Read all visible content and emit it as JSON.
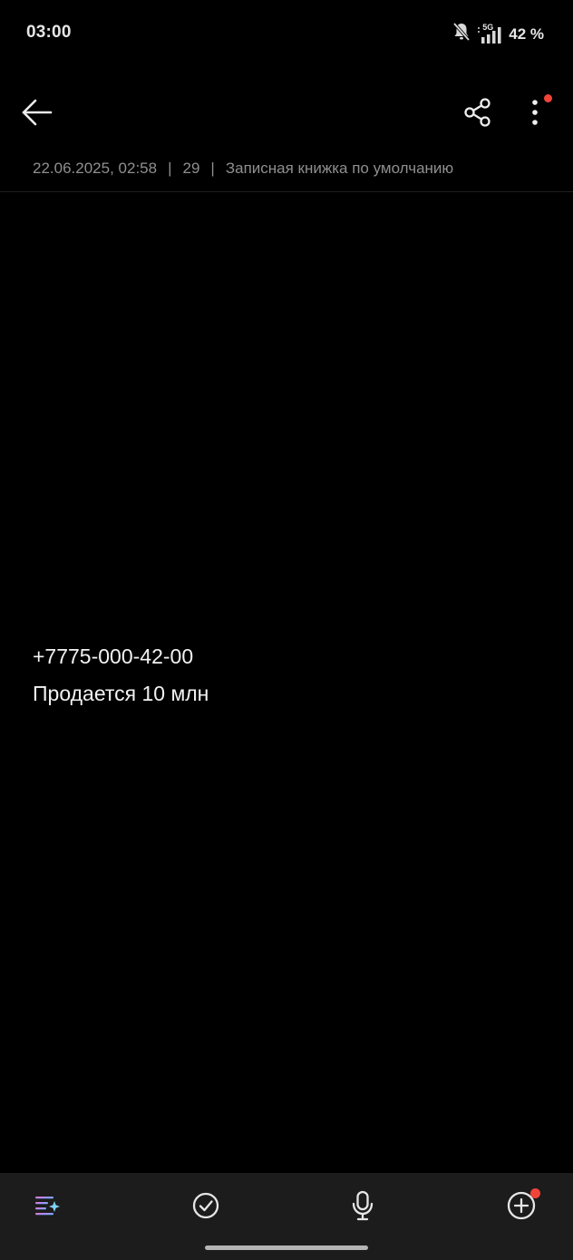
{
  "status_bar": {
    "time": "03:00",
    "network": "5G",
    "battery": "42 %",
    "icons": [
      "bell-mute-icon",
      "signal-icon"
    ]
  },
  "toolbar": {
    "icons": [
      "back-arrow-icon",
      "share-icon",
      "more-vert-icon"
    ]
  },
  "note": {
    "meta": {
      "datetime": "22.06.2025, 02:58",
      "char_count": "29",
      "notebook": "Записная книжка по умолчанию"
    },
    "lines": [
      "+7775-000-42-00",
      "Продается 10 млн"
    ]
  },
  "bottom_bar": {
    "icons": [
      "ai-sparkle-icon",
      "checklist-icon",
      "microphone-icon",
      "add-circle-icon"
    ]
  },
  "colors": {
    "background": "#000000",
    "text": "#f2f2f2",
    "meta_text": "#8f8f8f",
    "bottom_bar": "#1c1c1c",
    "badge": "#f04438"
  }
}
